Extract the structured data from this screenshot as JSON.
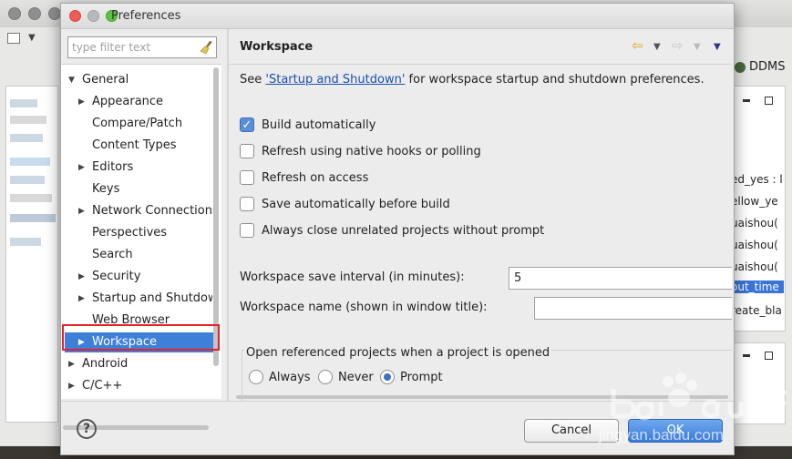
{
  "background": {
    "perspective_label": "DDMS",
    "code_lines": [
      "ed_yes : l",
      "ellow_ye",
      "uaishou(",
      "uaishou(",
      "uaishou(",
      "out_time :",
      "reate_bla"
    ]
  },
  "dialog": {
    "title": "Preferences",
    "filter_placeholder": "type filter text",
    "tree": [
      {
        "label": "General",
        "expanded": true,
        "level": 0
      },
      {
        "label": "Appearance",
        "level": 1,
        "arrow": true
      },
      {
        "label": "Compare/Patch",
        "level": 1
      },
      {
        "label": "Content Types",
        "level": 1
      },
      {
        "label": "Editors",
        "level": 1,
        "arrow": true
      },
      {
        "label": "Keys",
        "level": 1
      },
      {
        "label": "Network Connections",
        "level": 1,
        "arrow": true
      },
      {
        "label": "Perspectives",
        "level": 1
      },
      {
        "label": "Search",
        "level": 1
      },
      {
        "label": "Security",
        "level": 1,
        "arrow": true
      },
      {
        "label": "Startup and Shutdown",
        "level": 1,
        "arrow": true
      },
      {
        "label": "Web Browser",
        "level": 1
      },
      {
        "label": "Workspace",
        "level": 1,
        "arrow": true,
        "selected": true
      },
      {
        "label": "Android",
        "level": 0,
        "arrow": true
      },
      {
        "label": "C/C++",
        "level": 0,
        "arrow": true
      }
    ],
    "page": {
      "title": "Workspace",
      "desc_prefix": "See ",
      "desc_link": "'Startup and Shutdown'",
      "desc_suffix": " for workspace startup and shutdown preferences.",
      "options": [
        {
          "label": "Build automatically",
          "checked": true
        },
        {
          "label": "Refresh using native hooks or polling",
          "checked": false
        },
        {
          "label": "Refresh on access",
          "checked": false
        },
        {
          "label": "Save automatically before build",
          "checked": false
        },
        {
          "label": "Always close unrelated projects without prompt",
          "checked": false
        }
      ],
      "save_interval_label": "Workspace save interval (in minutes):",
      "save_interval_value": "5",
      "name_label": "Workspace name (shown in window title):",
      "name_value": "",
      "group_title": "Open referenced projects when a project is opened",
      "radios": [
        {
          "label": "Always",
          "selected": false
        },
        {
          "label": "Never",
          "selected": false
        },
        {
          "label": "Prompt",
          "selected": true
        }
      ]
    },
    "buttons": {
      "help": "?",
      "cancel": "Cancel",
      "ok": "OK"
    }
  },
  "colors": {
    "selection": "#3d7fd9",
    "highlight_frame": "#e8202a",
    "link": "#1a4fb3"
  }
}
